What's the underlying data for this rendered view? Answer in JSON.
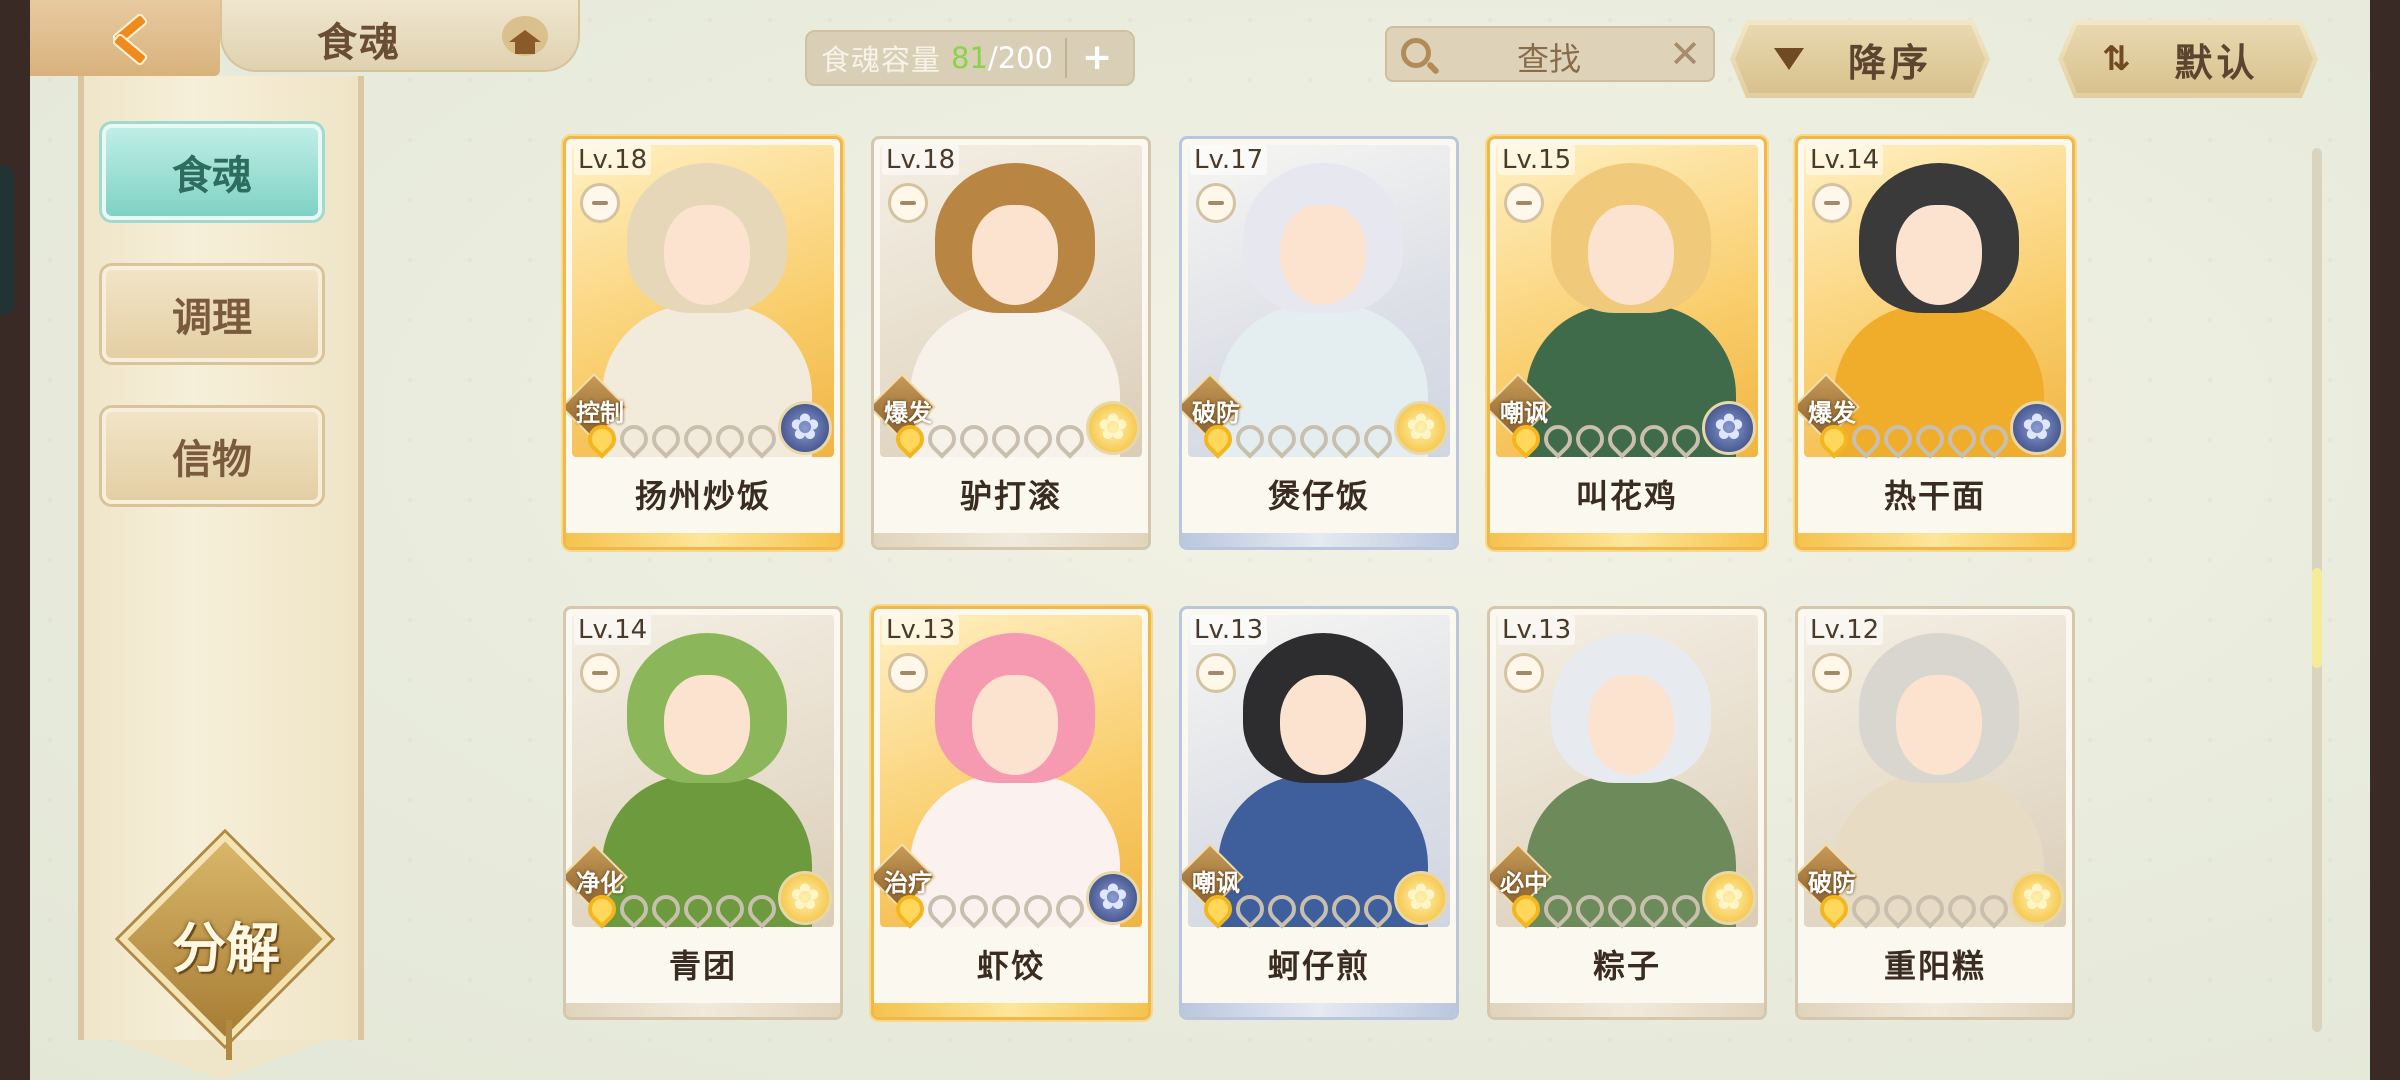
{
  "header": {
    "title": "食魂",
    "capacity": {
      "label": "食魂容量",
      "current": "81",
      "separator": "/",
      "max": "200",
      "add": "+"
    },
    "search": {
      "label": "查找",
      "clear": "✕"
    },
    "sort_order": {
      "label": "降序",
      "icon": "triangle-down-icon"
    },
    "sort_mode": {
      "label": "默认",
      "icon": "swap-arrows-icon"
    }
  },
  "sidebar": {
    "tabs": [
      {
        "label": "食魂",
        "active": true
      },
      {
        "label": "调理",
        "active": false
      },
      {
        "label": "信物",
        "active": false
      }
    ],
    "decompose": "分解"
  },
  "cards": [
    {
      "level": "Lv.18",
      "role": "控制",
      "name": "扬州炒饭",
      "stars": 1,
      "rarity": "gold",
      "badge": "blue",
      "hair": "#e6d7b8",
      "outfit": "#f2eadb"
    },
    {
      "level": "Lv.18",
      "role": "爆发",
      "name": "驴打滚",
      "stars": 1,
      "rarity": "plain",
      "badge": "gold",
      "hair": "#b98542",
      "outfit": "#f6f2ea"
    },
    {
      "level": "Lv.17",
      "role": "破防",
      "name": "煲仔饭",
      "stars": 1,
      "rarity": "blue",
      "badge": "gold",
      "hair": "#e7e7ef",
      "outfit": "#e4eef0"
    },
    {
      "level": "Lv.15",
      "role": "嘲讽",
      "name": "叫花鸡",
      "stars": 1,
      "rarity": "gold",
      "badge": "blue",
      "hair": "#f0c97a",
      "outfit": "#3f6b4a"
    },
    {
      "level": "Lv.14",
      "role": "爆发",
      "name": "热干面",
      "stars": 1,
      "rarity": "gold",
      "badge": "blue",
      "hair": "#3a3a3a",
      "outfit": "#f0ad2c"
    },
    {
      "level": "Lv.14",
      "role": "净化",
      "name": "青团",
      "stars": 1,
      "rarity": "plain",
      "badge": "gold",
      "hair": "#8cb65a",
      "outfit": "#6c9a3c"
    },
    {
      "level": "Lv.13",
      "role": "治疗",
      "name": "虾饺",
      "stars": 1,
      "rarity": "gold",
      "badge": "blue",
      "hair": "#f59ab0",
      "outfit": "#fbf2f0"
    },
    {
      "level": "Lv.13",
      "role": "嘲讽",
      "name": "蚵仔煎",
      "stars": 1,
      "rarity": "blue",
      "badge": "gold",
      "hair": "#2d2d30",
      "outfit": "#3e5f9c"
    },
    {
      "level": "Lv.13",
      "role": "必中",
      "name": "粽子",
      "stars": 1,
      "rarity": "plain",
      "badge": "gold",
      "hair": "#e7ebef",
      "outfit": "#6d8b5a"
    },
    {
      "level": "Lv.12",
      "role": "破防",
      "name": "重阳糕",
      "stars": 1,
      "rarity": "plain",
      "badge": "gold",
      "hair": "#d9d6cf",
      "outfit": "#e7dcc3"
    }
  ],
  "colors": {
    "accent_active_tab": "#7fd2c4",
    "capacity_current": "#8bd24a",
    "gold_frame": "#f0b84a"
  }
}
